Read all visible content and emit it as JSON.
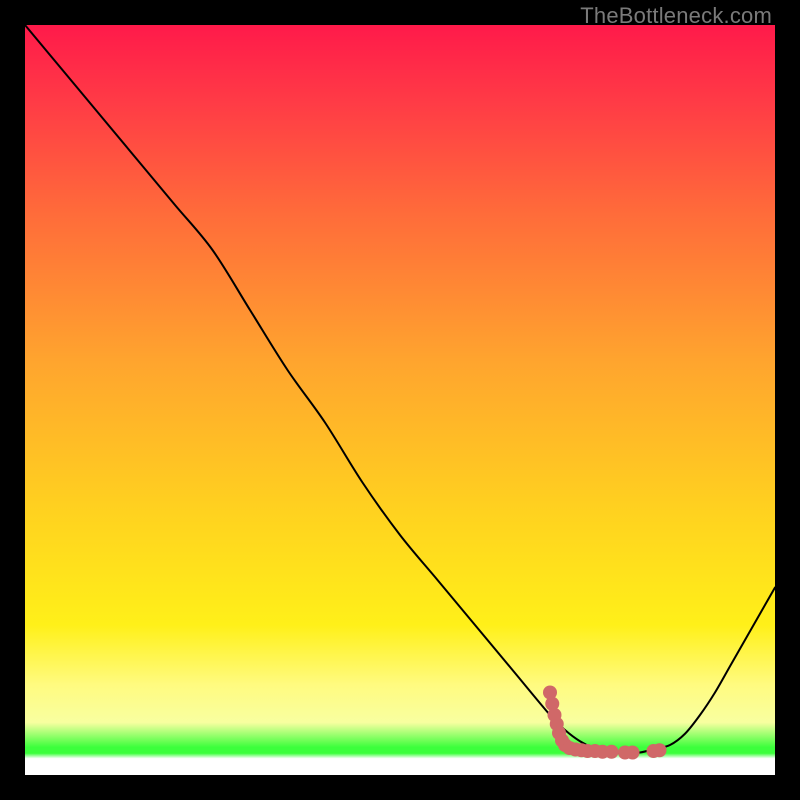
{
  "attribution": "TheBottleneck.com",
  "chart_data": {
    "type": "line",
    "title": "",
    "xlabel": "",
    "ylabel": "",
    "xlim": [
      0,
      100
    ],
    "ylim": [
      0,
      100
    ],
    "grid": false,
    "series": [
      {
        "name": "bottleneck-curve",
        "x": [
          0,
          5,
          10,
          15,
          20,
          25,
          30,
          35,
          40,
          45,
          50,
          55,
          60,
          65,
          70,
          72,
          74,
          76,
          78,
          80,
          82,
          84,
          86,
          88,
          90,
          92,
          94,
          96,
          98,
          100
        ],
        "y": [
          100,
          94,
          88,
          82,
          76,
          70,
          62,
          54,
          47,
          39,
          32,
          26,
          20,
          14,
          8,
          6,
          4.5,
          3.5,
          3,
          3,
          3,
          3.5,
          4,
          5.5,
          8,
          11,
          14.5,
          18,
          21.5,
          25
        ],
        "color": "#000000",
        "stroke_width": 2
      }
    ],
    "markers": [
      {
        "name": "overlay-cluster",
        "color": "#d06868",
        "points": [
          {
            "x": 70.0,
            "y": 11.0
          },
          {
            "x": 70.3,
            "y": 9.5
          },
          {
            "x": 70.6,
            "y": 8.0
          },
          {
            "x": 70.9,
            "y": 6.8
          },
          {
            "x": 71.2,
            "y": 5.6
          },
          {
            "x": 71.6,
            "y": 4.6
          },
          {
            "x": 72.0,
            "y": 4.0
          },
          {
            "x": 72.6,
            "y": 3.6
          },
          {
            "x": 73.4,
            "y": 3.4
          },
          {
            "x": 74.2,
            "y": 3.3
          },
          {
            "x": 75.0,
            "y": 3.2
          },
          {
            "x": 76.0,
            "y": 3.2
          },
          {
            "x": 77.0,
            "y": 3.1
          },
          {
            "x": 78.2,
            "y": 3.1
          },
          {
            "x": 80.0,
            "y": 3.0
          },
          {
            "x": 81.0,
            "y": 3.0
          },
          {
            "x": 83.8,
            "y": 3.2
          },
          {
            "x": 84.6,
            "y": 3.3
          }
        ]
      }
    ],
    "background_gradient": {
      "stops": [
        {
          "pos": 0.0,
          "color": "#ff1a4a"
        },
        {
          "pos": 0.1,
          "color": "#ff3a46"
        },
        {
          "pos": 0.25,
          "color": "#ff6b3a"
        },
        {
          "pos": 0.45,
          "color": "#ffa52e"
        },
        {
          "pos": 0.65,
          "color": "#ffd21f"
        },
        {
          "pos": 0.8,
          "color": "#fff019"
        },
        {
          "pos": 0.88,
          "color": "#fffb80"
        },
        {
          "pos": 0.93,
          "color": "#f8ffa0"
        },
        {
          "pos": 0.963,
          "color": "#3cff3c"
        },
        {
          "pos": 0.971,
          "color": "#3cff3c"
        },
        {
          "pos": 0.978,
          "color": "#ffffff"
        },
        {
          "pos": 1.0,
          "color": "#ffffff"
        }
      ]
    }
  }
}
